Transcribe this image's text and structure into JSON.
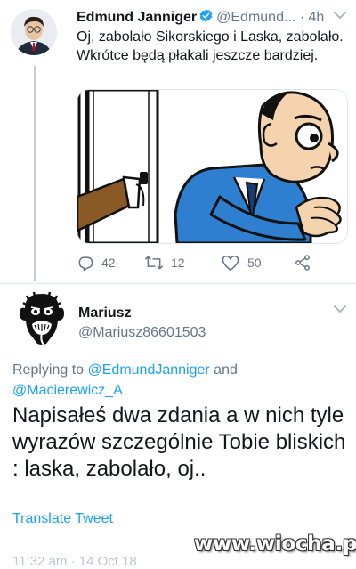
{
  "tweet1": {
    "display_name": "Edmund Janniger",
    "handle": "@Edmund...",
    "separator": "·",
    "time": "4h",
    "text": "Oj, zabolało Sikorskiego i Laska, zabolało. Wkrótce będą płakali jeszcze bardziej.",
    "replies": "42",
    "retweets": "12",
    "likes": "50"
  },
  "tweet2": {
    "display_name": "Mariusz",
    "handle": "@Mariusz86601503",
    "replying_prefix": "Replying to ",
    "replying_to_1": "@EdmundJanniger",
    "replying_and": " and",
    "replying_to_2": "@Macierewicz_A",
    "text": "Napisałeś dwa zdania a w nich tyle wyrazów szczególnie Tobie bliskich : laska, zabolało, oj..",
    "translate_label": "Translate Tweet",
    "timestamp": "11:32 am · 14 Oct 18"
  },
  "watermark": "www.wiocha.pl",
  "colors": {
    "accent": "#1da1f2",
    "secondary_text": "#657786",
    "primary_text": "#14171a",
    "divider": "#e1e8ed",
    "illustration_jacket": "#2f7fd0",
    "illustration_skin": "#f4d3ae"
  },
  "icons": {
    "verified": "verified-badge-icon",
    "reply": "reply-icon",
    "retweet": "retweet-icon",
    "like": "heart-icon",
    "share": "share-icon",
    "caret": "chevron-down-icon"
  }
}
